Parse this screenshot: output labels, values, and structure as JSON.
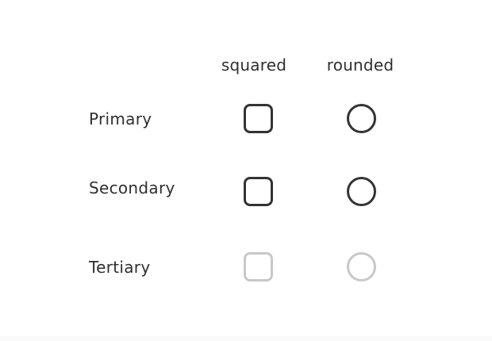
{
  "columns": {
    "squared_label": "squared",
    "rounded_label": "rounded"
  },
  "rows": [
    {
      "label": "Primary",
      "variant": "primary",
      "border_color": "#333333"
    },
    {
      "label": "Secondary",
      "variant": "secondary",
      "border_color": "#333333"
    },
    {
      "label": "Tertiary",
      "variant": "tertiary",
      "border_color": "#c8c8c8"
    }
  ],
  "colors": {
    "text": "#2f2f2f",
    "background": "#ffffff"
  }
}
